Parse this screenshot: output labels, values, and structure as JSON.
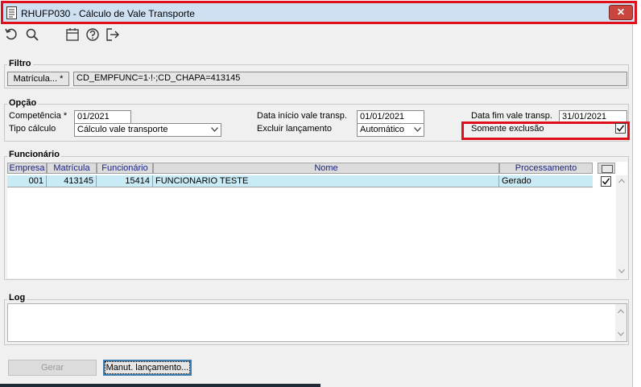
{
  "window": {
    "title": "RHUFP030 - Cálculo de Vale Transporte",
    "close_glyph": "✕"
  },
  "toolbar": {
    "icons": [
      "undo-icon",
      "search-icon",
      "calendar-icon",
      "help-icon",
      "exit-icon"
    ]
  },
  "filtro": {
    "group_label": "Filtro",
    "matricula_button": "Matrícula... *",
    "filter_value": "CD_EMPFUNC=1∙!∙;CD_CHAPA=413145"
  },
  "opcao": {
    "group_label": "Opção",
    "competencia_label": "Competência *",
    "competencia_value": "01/2021",
    "tipo_calculo_label": "Tipo cálculo",
    "tipo_calculo_value": "Cálculo vale transporte",
    "data_inicio_label": "Data início vale transp.",
    "data_inicio_value": "01/01/2021",
    "excluir_label": "Excluir lançamento",
    "excluir_value": "Automático",
    "data_fim_label": "Data fim vale transp.",
    "data_fim_value": "31/01/2021",
    "somente_exclusao_label": "Somente exclusão",
    "somente_exclusao_checked": true
  },
  "funcionario": {
    "group_label": "Funcionário",
    "columns": [
      "Empresa",
      "Matrícula",
      "Funcionário",
      "Nome",
      "Processamento"
    ],
    "rows": [
      {
        "empresa": "001",
        "matricula": "413145",
        "funcionario": "15414",
        "nome": "FUNCIONARIO TESTE",
        "processamento": "Gerado",
        "checked": true
      }
    ]
  },
  "log": {
    "group_label": "Log",
    "text": ""
  },
  "footer": {
    "gerar_label": "Gerar",
    "manut_label": "Manut. lançamento..."
  },
  "colors": {
    "highlight": "#e0101a",
    "grid_header_text": "#1a237e",
    "selected_row": "#c8ebf6"
  }
}
